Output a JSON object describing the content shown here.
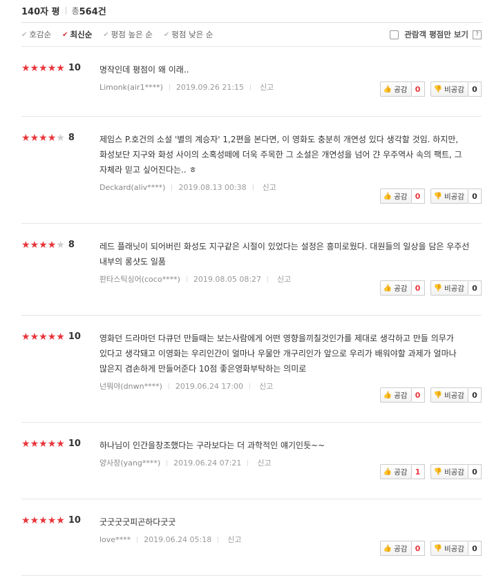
{
  "header": {
    "title": "140자 평",
    "total_label": "총",
    "total_count": "564건"
  },
  "sort": {
    "items": [
      {
        "label": "호감순",
        "active": false
      },
      {
        "label": "최신순",
        "active": true
      },
      {
        "label": "평점 높은 순",
        "active": false
      },
      {
        "label": "평점 낮은 순",
        "active": false
      }
    ],
    "viewer_only_label": "관람객 평점만 보기",
    "help_label": "?"
  },
  "labels": {
    "like": "공감",
    "dislike": "비공감",
    "report": "신고"
  },
  "colors": {
    "star_on": "#e8343a",
    "star_off": "#cccccc",
    "like_count": "#e8343a"
  },
  "reviews": [
    {
      "score": "10",
      "stars": 5,
      "text": "명작인데 평점이 왜 이래..",
      "writer": "Limonk(air1****)",
      "date": "2019.09.26 21:15",
      "likes": "0",
      "dislikes": "0"
    },
    {
      "score": "8",
      "stars": 4,
      "text": "제임스 P.호건의 소설 '별의 계승자' 1,2편을 본다면, 이 영화도 충분히 개연성 있다 생각할 것임. 하지만, 화성보단 지구와 화성 사이의 소혹성떼에 더욱 주목한 그 소설은 개연성을 넘어 갼 우주역사 속의 팩트, 그 자체라 믿고 싶어진다는.. ㅎ",
      "writer": "Deckard(aliv****)",
      "date": "2019.08.13 00:38",
      "likes": "0",
      "dislikes": "0"
    },
    {
      "score": "8",
      "stars": 4,
      "text": "레드 플래닛이 되어버린 화성도 지구같은 시절이 있었다는 설정은 흥미로웠다. 대원들의 일상을 담은 우주선 내부의 롱샷도 일품",
      "writer": "판타스틱싱어(coco****)",
      "date": "2019.08.05 08:27",
      "likes": "0",
      "dislikes": "0"
    },
    {
      "score": "10",
      "stars": 5,
      "text": "영화던 드라마던 다큐던 만들때는 보는사람에게 어떤 영향을끼칠것인가를 제대로 생각하고 만들 의무가 있다고 생각돼고 이영화는 우리인간이 얼마나 우물안 개구리인가 앞으로 우리가 배워야할 과제가 얼마나 많은지 겸손하게 만들어준다 10점 좋은영화부탁하는 의미로",
      "writer": "넌뭐야(dnwn****)",
      "date": "2019.06.24 17:00",
      "likes": "0",
      "dislikes": "0"
    },
    {
      "score": "10",
      "stars": 5,
      "text": "하나님이 인간을창조했다는 구라보다는 더 과학적인 얘기인듯~~",
      "writer": "양사장(yang****)",
      "date": "2019.06.24 07:21",
      "likes": "1",
      "dislikes": "0"
    },
    {
      "score": "10",
      "stars": 5,
      "text": "굿굿굿굿피곤하다굿굿",
      "writer": "love****",
      "date": "2019.06.24 05:18",
      "likes": "0",
      "dislikes": "0"
    }
  ]
}
